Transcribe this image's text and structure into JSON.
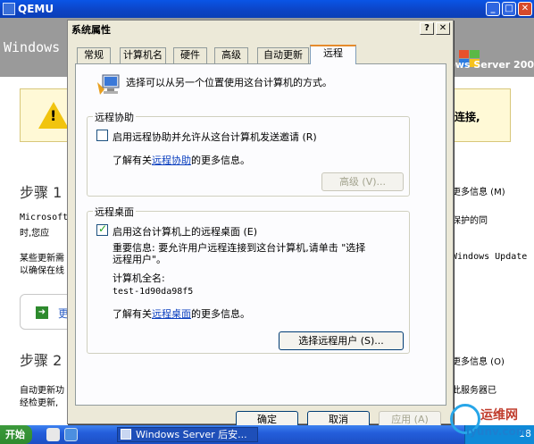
{
  "qemu": {
    "title": "QEMU"
  },
  "background": {
    "header_text": "Windows",
    "brand_text": "Windows Server 200",
    "warning_right": "连接,",
    "step1": "步骤 1",
    "more_info_1": "更多信息 (M)",
    "text_ms": "Microsoft",
    "text_ms_right": "保护的同",
    "text_time": "时,您应",
    "text_some": "某些更新需",
    "text_ensure": "以确保在线",
    "text_wu": "Windows Update",
    "button_partial": "更",
    "step2": "步骤 2",
    "more_info_2": "更多信息 (O)",
    "text_auto": "自动更新功",
    "text_auto_right": "此服务器已",
    "text_check": "经检更新,"
  },
  "dialog": {
    "title": "系统属性",
    "help_btn": "?",
    "close_btn": "✕",
    "tabs": [
      {
        "label": "常规"
      },
      {
        "label": "计算机名"
      },
      {
        "label": "硬件"
      },
      {
        "label": "高级"
      },
      {
        "label": "自动更新"
      },
      {
        "label": "远程"
      }
    ],
    "intro": "选择可以从另一个位置使用这台计算机的方式。",
    "remote_assistance": {
      "legend": "远程协助",
      "checkbox_label": "启用远程协助并允许从这台计算机发送邀请 (R)",
      "checked": false,
      "learn_prefix": "了解有关",
      "learn_link": "远程协助",
      "learn_suffix": "的更多信息。",
      "advanced_btn": "高级 (V)..."
    },
    "remote_desktop": {
      "legend": "远程桌面",
      "checkbox_label": "启用这台计算机上的远程桌面 (E)",
      "checked": true,
      "important_line1": "重要信息: 要允许用户远程连接到这台计算机,请单击 \"选择",
      "important_line2": "远程用户\"。",
      "computer_name_label": "计算机全名:",
      "computer_name": "test-1d90da98f5",
      "learn_prefix": "了解有关",
      "learn_link": "远程桌面",
      "learn_suffix": "的更多信息。",
      "select_users_btn": "选择远程用户 (S)..."
    },
    "ok_btn": "确定",
    "cancel_btn": "取消",
    "apply_btn": "应用 (A)"
  },
  "taskbar": {
    "start_label": "开始",
    "task_item": "Windows Server 后安...",
    "clock": "18"
  },
  "watermark": {
    "line1": "运维网",
    "line2": "iyunv.com"
  }
}
